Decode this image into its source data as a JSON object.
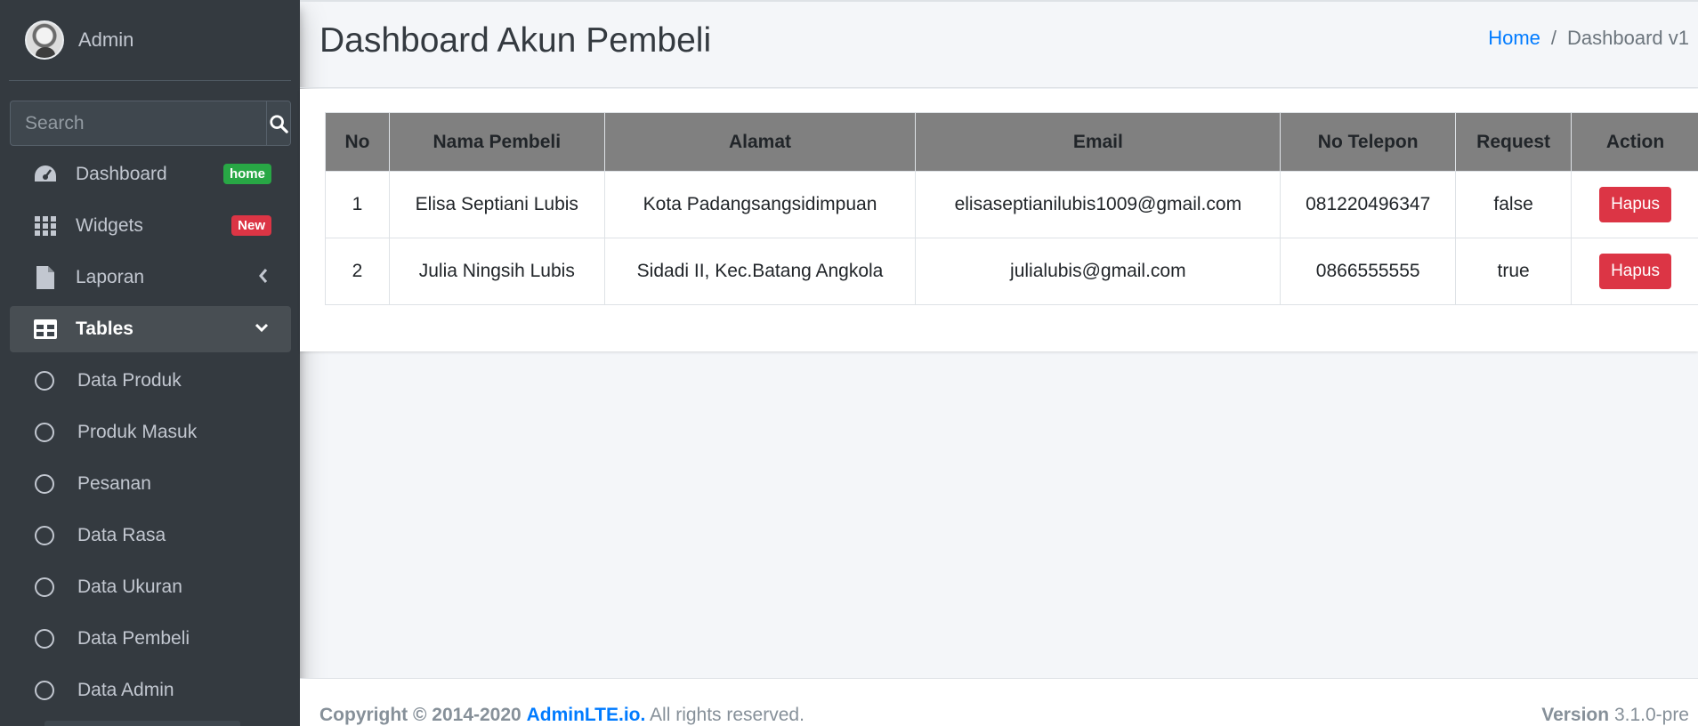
{
  "sidebar": {
    "user_name": "Admin",
    "search_placeholder": "Search",
    "items": [
      {
        "label": "Dashboard",
        "badge": "home"
      },
      {
        "label": "Widgets",
        "badge": "New"
      },
      {
        "label": "Laporan"
      },
      {
        "label": "Tables"
      }
    ],
    "sub_items": [
      "Data Produk",
      "Produk Masuk",
      "Pesanan",
      "Data Rasa",
      "Data Ukuran",
      "Data Pembeli",
      "Data Admin"
    ]
  },
  "header": {
    "title": "Dashboard Akun Pembeli",
    "breadcrumb_home": "Home",
    "breadcrumb_sep": "/",
    "breadcrumb_current": "Dashboard v1"
  },
  "table": {
    "columns": [
      "No",
      "Nama Pembeli",
      "Alamat",
      "Email",
      "No Telepon",
      "Request",
      "Action"
    ],
    "rows": [
      {
        "no": "1",
        "nama": "Elisa Septiani Lubis",
        "alamat": "Kota Padangsangsidimpuan",
        "email": "elisaseptianilubis1009@gmail.com",
        "telepon": "081220496347",
        "request": "false",
        "action": "Hapus"
      },
      {
        "no": "2",
        "nama": "Julia Ningsih Lubis",
        "alamat": "Sidadi II, Kec.Batang Angkola",
        "email": "julialubis@gmail.com",
        "telepon": "0866555555",
        "request": "true",
        "action": "Hapus"
      }
    ]
  },
  "footer": {
    "copyright": "Copyright © 2014-2020",
    "brand": "AdminLTE.io.",
    "rights": "All rights reserved.",
    "version_label": "Version",
    "version": "3.1.0-pre"
  },
  "colors": {
    "sidebar_bg": "#343a40",
    "accent": "#007bff",
    "danger": "#dc3545",
    "success": "#28a745",
    "table_header": "#808080"
  },
  "icons": {
    "search": "search-icon",
    "dashboard": "tachometer-icon",
    "widgets": "grid-icon",
    "laporan": "file-icon",
    "tables": "table-icon"
  }
}
